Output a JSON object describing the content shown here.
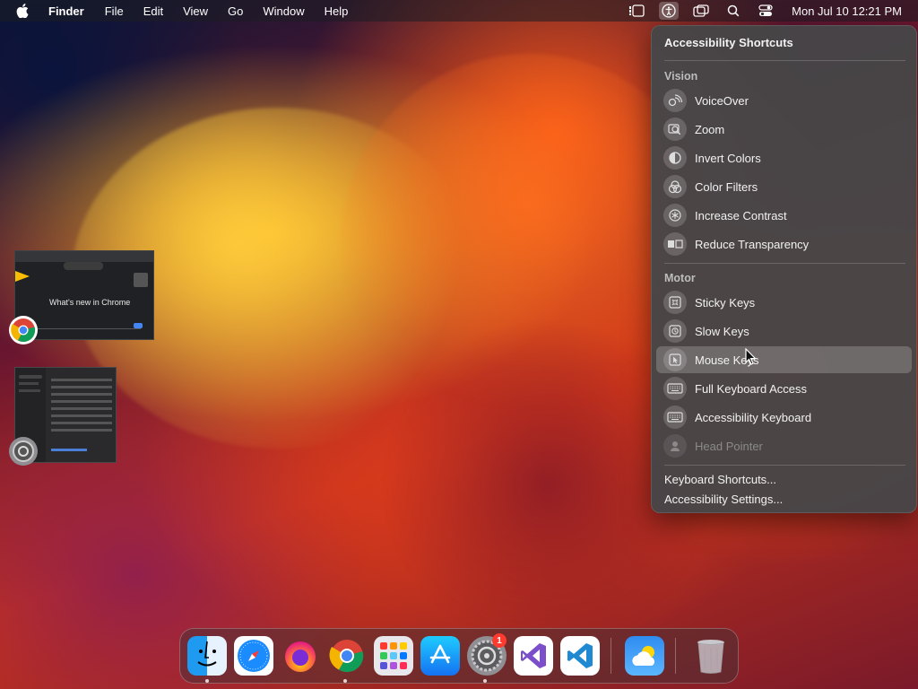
{
  "menubar": {
    "app_name": "Finder",
    "menus": [
      "File",
      "Edit",
      "View",
      "Go",
      "Window",
      "Help"
    ],
    "clock": "Mon Jul 10  12:21 PM"
  },
  "panel": {
    "title": "Accessibility Shortcuts",
    "sections": [
      {
        "label": "Vision",
        "items": [
          {
            "label": "VoiceOver",
            "icon": "voiceover-icon"
          },
          {
            "label": "Zoom",
            "icon": "zoom-icon"
          },
          {
            "label": "Invert Colors",
            "icon": "invert-colors-icon"
          },
          {
            "label": "Color Filters",
            "icon": "color-filters-icon"
          },
          {
            "label": "Increase Contrast",
            "icon": "increase-contrast-icon"
          },
          {
            "label": "Reduce Transparency",
            "icon": "reduce-transparency-icon"
          }
        ]
      },
      {
        "label": "Motor",
        "items": [
          {
            "label": "Sticky Keys",
            "icon": "sticky-keys-icon"
          },
          {
            "label": "Slow Keys",
            "icon": "slow-keys-icon"
          },
          {
            "label": "Mouse Keys",
            "icon": "mouse-keys-icon",
            "highlighted": true
          },
          {
            "label": "Full Keyboard Access",
            "icon": "keyboard-icon"
          },
          {
            "label": "Accessibility Keyboard",
            "icon": "accessibility-keyboard-icon"
          },
          {
            "label": "Head Pointer",
            "icon": "head-pointer-icon",
            "disabled": true
          }
        ]
      }
    ],
    "links": [
      "Keyboard Shortcuts...",
      "Accessibility Settings..."
    ]
  },
  "thumbnails": {
    "chrome_text": "What's new in Chrome"
  },
  "dock": {
    "apps": [
      "Finder",
      "Safari",
      "Firefox",
      "Google Chrome",
      "Launchpad",
      "App Store",
      "System Settings",
      "Visual Studio",
      "Visual Studio Code",
      "Weather",
      "Trash"
    ],
    "settings_badge": "1"
  }
}
